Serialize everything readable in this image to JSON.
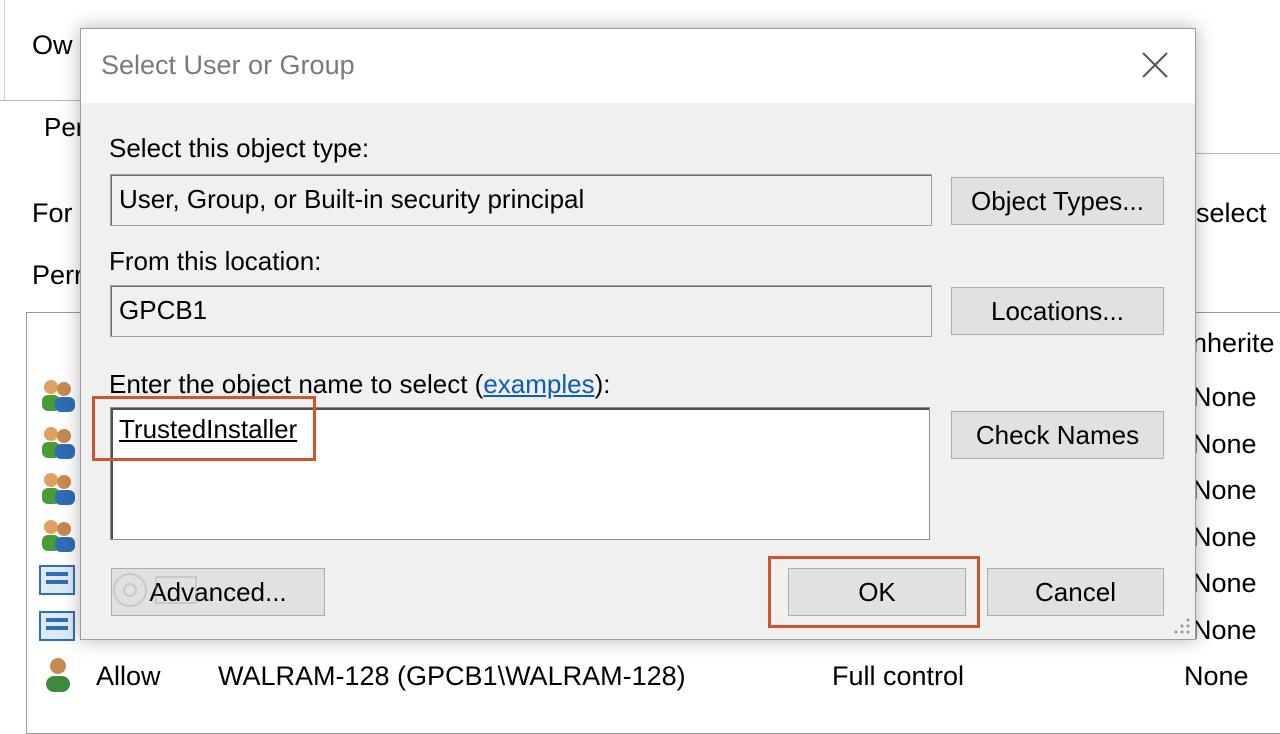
{
  "background": {
    "owner_label": "Ow",
    "tab_label": "Per",
    "for_text": "For",
    "select_text": "select",
    "perm_label": "Perr",
    "col_inherited": "nherite",
    "row_values": [
      "None",
      "None",
      "None",
      "None",
      "None",
      "None"
    ],
    "last_row": {
      "type": "Allow",
      "principal": "WALRAM-128 (GPCB1\\WALRAM-128)",
      "access": "Full control",
      "inherited": "None"
    }
  },
  "dialog": {
    "title": "Select User or Group",
    "object_type_label": "Select this object type:",
    "object_type_value": "User, Group, or Built-in security principal",
    "object_types_button": "Object Types...",
    "location_label": "From this location:",
    "location_value": "GPCB1",
    "locations_button": "Locations...",
    "enter_name_prefix": "Enter the object name to select (",
    "examples_link": "examples",
    "enter_name_suffix": "):",
    "object_name_value": "TrustedInstaller",
    "check_names_button": "Check Names",
    "advanced_button": "Advanced...",
    "ok_button": "OK",
    "cancel_button": "Cancel"
  },
  "colors": {
    "highlight": "#d4532f",
    "link": "#0b5cbb",
    "dialog_bg": "#f0f0f0"
  },
  "icons": [
    "close-icon",
    "group-icon",
    "system-icon",
    "user-icon",
    "resize-grip-icon"
  ]
}
